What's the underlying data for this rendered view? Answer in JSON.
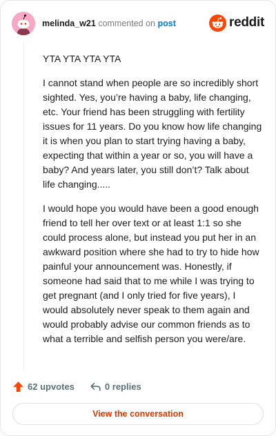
{
  "header": {
    "username": "melinda_w21",
    "action_text": "commented on",
    "target_text": "post",
    "brand": "reddit",
    "brand_color": "#ff4500"
  },
  "comment": {
    "paragraphs": [
      "YTA YTA YTA YTA",
      "I cannot stand when people are so incredibly short sighted. Yes, you’re having a baby, life changing, etc. Your friend has been struggling with fertility issues for 11 years. Do you know how life changing it is when you plan to start trying having a baby, expecting that within a year or so, you will have a baby? And years later, you still don’t? Talk about life changing.....",
      "I would hope you would have been a good enough friend to tell her over text or at least 1:1 so she could process alone, but instead you put her in an awkward position where she had to try to hide how painful your announcement was. Honestly, if someone had said that to me while I was trying to get pregnant (and I only tried for five years), I would absolutely never speak to them again and would probably advise our common friends as to what a terrible and selfish person you were/are."
    ]
  },
  "actions": {
    "upvotes_label": "62 upvotes",
    "replies_label": "0 replies",
    "upvote_icon": "upvote-arrow-icon",
    "reply_icon": "reply-arrow-icon",
    "upvote_color": "#ff4500"
  },
  "footer": {
    "button_label": "View the conversation",
    "button_color": "#d93a00"
  }
}
